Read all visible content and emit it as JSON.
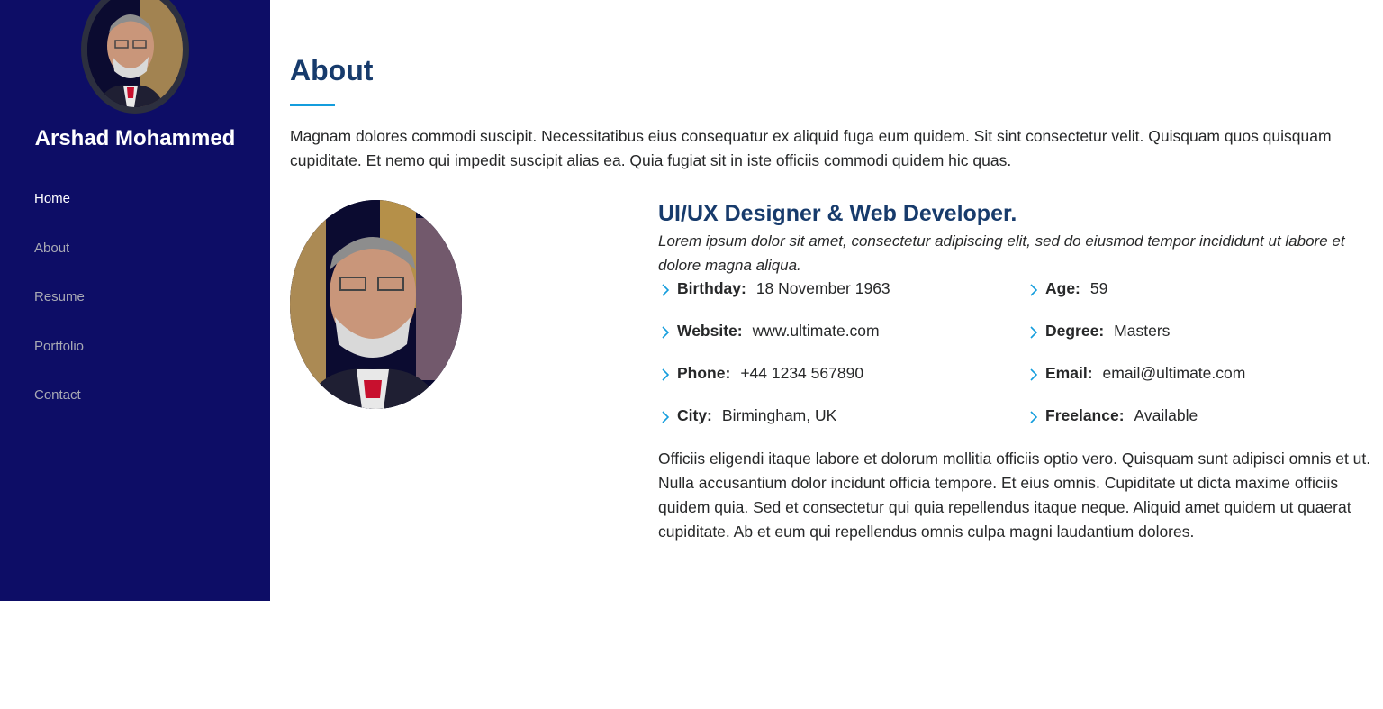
{
  "sidebar": {
    "name": "Arshad Mohammed",
    "nav": [
      "Home",
      "About",
      "Resume",
      "Portfolio",
      "Contact"
    ],
    "active_index": 0
  },
  "about": {
    "title": "About",
    "intro": "Magnam dolores commodi suscipit. Necessitatibus eius consequatur ex aliquid fuga eum quidem. Sit sint consectetur velit. Quisquam quos quisquam cupiditate. Et nemo qui impedit suscipit alias ea. Quia fugiat sit in iste officiis commodi quidem hic quas.",
    "role": "UI/UX Designer & Web Developer.",
    "tagline": "Lorem ipsum dolor sit amet, consectetur adipiscing elit, sed do eiusmod tempor incididunt ut labore et dolore magna aliqua.",
    "facts": [
      {
        "label": "Birthday:",
        "value": "18 November 1963"
      },
      {
        "label": "Age:",
        "value": "59"
      },
      {
        "label": "Website:",
        "value": "www.ultimate.com"
      },
      {
        "label": "Degree:",
        "value": "Masters"
      },
      {
        "label": "Phone:",
        "value": "+44 1234 567890"
      },
      {
        "label": "Email:",
        "value": "email@ultimate.com"
      },
      {
        "label": "City:",
        "value": "Birmingham, UK"
      },
      {
        "label": "Freelance:",
        "value": "Available"
      }
    ],
    "outro": "Officiis eligendi itaque labore et dolorum mollitia officiis optio vero. Quisquam sunt adipisci omnis et ut. Nulla accusantium dolor incidunt officia tempore. Et eius omnis. Cupiditate ut dicta maxime officiis quidem quia. Sed et consectetur qui quia repellendus itaque neque. Aliquid amet quidem ut quaerat cupiditate. Ab et eum qui repellendus omnis culpa magni laudantium dolores."
  },
  "colors": {
    "sidebar_bg": "#0d0d66",
    "heading": "#173b6c",
    "accent": "#149ddd",
    "nav_text": "#a8a9b4"
  },
  "icons": {
    "fact_bullet": "chevron-right-icon"
  }
}
